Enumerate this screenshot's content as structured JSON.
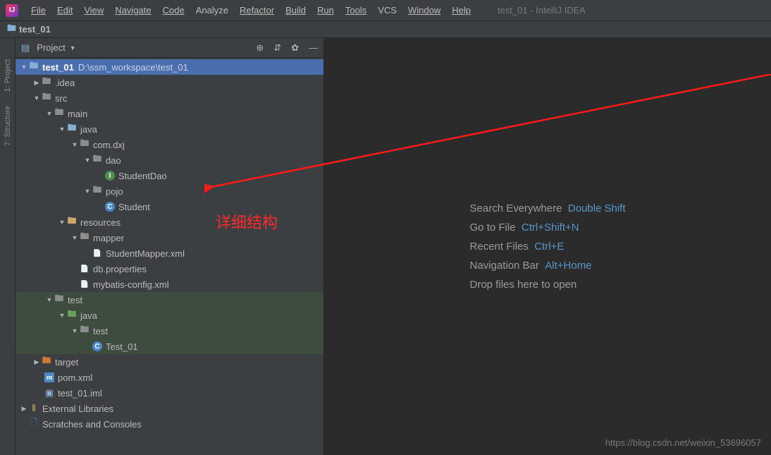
{
  "window": {
    "title": "test_01 - IntelliJ IDEA"
  },
  "menu": {
    "file": "File",
    "edit": "Edit",
    "view": "View",
    "navigate": "Navigate",
    "code": "Code",
    "analyze": "Analyze",
    "refactor": "Refactor",
    "build": "Build",
    "run": "Run",
    "tools": "Tools",
    "vcs": "VCS",
    "window": "Window",
    "help": "Help"
  },
  "breadcrumb": {
    "project": "test_01"
  },
  "toolstrip": {
    "project": "1: Project",
    "structure": "7: Structure"
  },
  "panel": {
    "title": "Project"
  },
  "tree": {
    "root": {
      "name": "test_01",
      "path": "D:\\ssm_workspace\\test_01"
    },
    "idea": ".idea",
    "src": "src",
    "main": "main",
    "java": "java",
    "comdxj": "com.dxj",
    "dao": "dao",
    "studentdao": "StudentDao",
    "pojo": "pojo",
    "student": "Student",
    "resources": "resources",
    "mapper": "mapper",
    "studentmapperxml": "StudentMapper.xml",
    "dbprops": "db.properties",
    "mybatisconfig": "mybatis-config.xml",
    "test": "test",
    "javatest": "java",
    "testpkg": "test",
    "test01class": "Test_01",
    "target": "target",
    "pom": "pom.xml",
    "iml": "test_01.iml",
    "extlib": "External Libraries",
    "scratches": "Scratches and Consoles"
  },
  "tips": {
    "search": {
      "label": "Search Everywhere",
      "key": "Double Shift"
    },
    "gotofile": {
      "label": "Go to File",
      "key": "Ctrl+Shift+N"
    },
    "recent": {
      "label": "Recent Files",
      "key": "Ctrl+E"
    },
    "navbar": {
      "label": "Navigation Bar",
      "key": "Alt+Home"
    },
    "drop": "Drop files here to open"
  },
  "annotation": {
    "text": "详细结构"
  },
  "watermark": "https://blog.csdn.net/weixin_53696057"
}
